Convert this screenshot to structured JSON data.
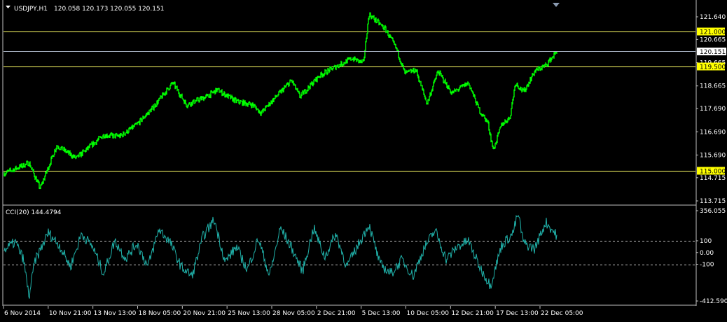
{
  "header": {
    "symbol_label": "USDJPY,H1",
    "ohlc_label": "120.058 120.173 120.055 120.151"
  },
  "colors": {
    "background": "#000000",
    "price_bars": "#00ff00",
    "indicator_line": "#20b2aa",
    "hline": "#ffff66",
    "current_price_line": "#a9b4c4",
    "frame": "#c0c0c0",
    "text": "#ffffff",
    "hline_label_bg": "#ffff00",
    "hline_label_text": "#000000"
  },
  "chart_data": [
    {
      "type": "line",
      "name": "price",
      "ylim": [
        113.715,
        121.64
      ],
      "y_ticks": [
        "121.640",
        "120.665",
        "119.665",
        "118.665",
        "117.690",
        "116.690",
        "115.690",
        "114.715",
        "113.715"
      ],
      "current_price": "120.151",
      "horizontal_lines": [
        {
          "value": "121.000"
        },
        {
          "value": "119.500"
        },
        {
          "value": "115.000"
        }
      ],
      "x": [
        "6 Nov 2014",
        "10 Nov 21:00",
        "13 Nov 13:00",
        "18 Nov 05:00",
        "20 Nov 21:00",
        "25 Nov 13:00",
        "28 Nov 05:00",
        "2 Dec 21:00",
        "5 Dec 13:00",
        "10 Dec 05:00",
        "12 Dec 21:00",
        "17 Dec 13:00",
        "22 Dec 05:00"
      ],
      "keypoints": [
        [
          0,
          114.9
        ],
        [
          0.045,
          115.35
        ],
        [
          0.065,
          114.25
        ],
        [
          0.095,
          116.1
        ],
        [
          0.13,
          115.55
        ],
        [
          0.18,
          116.55
        ],
        [
          0.21,
          116.5
        ],
        [
          0.24,
          117.0
        ],
        [
          0.27,
          117.75
        ],
        [
          0.305,
          118.8
        ],
        [
          0.33,
          117.85
        ],
        [
          0.37,
          118.25
        ],
        [
          0.385,
          118.5
        ],
        [
          0.42,
          118.0
        ],
        [
          0.45,
          117.85
        ],
        [
          0.465,
          117.5
        ],
        [
          0.48,
          117.9
        ],
        [
          0.52,
          118.9
        ],
        [
          0.535,
          118.2
        ],
        [
          0.57,
          119.1
        ],
        [
          0.6,
          119.5
        ],
        [
          0.63,
          119.85
        ],
        [
          0.65,
          119.65
        ],
        [
          0.66,
          121.75
        ],
        [
          0.69,
          121.1
        ],
        [
          0.71,
          120.25
        ],
        [
          0.725,
          119.2
        ],
        [
          0.745,
          119.35
        ],
        [
          0.765,
          117.9
        ],
        [
          0.785,
          119.3
        ],
        [
          0.81,
          118.35
        ],
        [
          0.84,
          118.8
        ],
        [
          0.86,
          117.6
        ],
        [
          0.875,
          117.1
        ],
        [
          0.885,
          115.9
        ],
        [
          0.9,
          117.0
        ],
        [
          0.915,
          117.3
        ],
        [
          0.925,
          118.8
        ],
        [
          0.94,
          118.4
        ],
        [
          0.96,
          119.3
        ],
        [
          0.98,
          119.55
        ],
        [
          1.0,
          120.15
        ]
      ]
    },
    {
      "type": "line",
      "name": "CCI(20)",
      "label": "CCI(20) 144.4794",
      "ylim": [
        -412.5903,
        356.055
      ],
      "y_ticks": [
        "356.055",
        "100",
        "0.00",
        "-100",
        "-412.5903"
      ],
      "levels": [
        100,
        -100
      ],
      "keypoints": [
        [
          0,
          20
        ],
        [
          0.02,
          90
        ],
        [
          0.035,
          -60
        ],
        [
          0.045,
          -380
        ],
        [
          0.055,
          -80
        ],
        [
          0.08,
          170
        ],
        [
          0.1,
          60
        ],
        [
          0.12,
          -120
        ],
        [
          0.14,
          160
        ],
        [
          0.16,
          50
        ],
        [
          0.18,
          -180
        ],
        [
          0.2,
          100
        ],
        [
          0.22,
          -50
        ],
        [
          0.24,
          80
        ],
        [
          0.26,
          -120
        ],
        [
          0.28,
          200
        ],
        [
          0.3,
          90
        ],
        [
          0.32,
          -120
        ],
        [
          0.34,
          -200
        ],
        [
          0.36,
          140
        ],
        [
          0.38,
          280
        ],
        [
          0.4,
          -80
        ],
        [
          0.42,
          50
        ],
        [
          0.44,
          -150
        ],
        [
          0.46,
          120
        ],
        [
          0.48,
          -200
        ],
        [
          0.5,
          210
        ],
        [
          0.52,
          40
        ],
        [
          0.54,
          -160
        ],
        [
          0.56,
          210
        ],
        [
          0.58,
          -40
        ],
        [
          0.6,
          160
        ],
        [
          0.62,
          -120
        ],
        [
          0.64,
          60
        ],
        [
          0.66,
          240
        ],
        [
          0.68,
          -100
        ],
        [
          0.7,
          -180
        ],
        [
          0.72,
          -60
        ],
        [
          0.74,
          -200
        ],
        [
          0.76,
          40
        ],
        [
          0.78,
          190
        ],
        [
          0.8,
          -60
        ],
        [
          0.82,
          50
        ],
        [
          0.84,
          100
        ],
        [
          0.86,
          -120
        ],
        [
          0.88,
          -280
        ],
        [
          0.9,
          60
        ],
        [
          0.92,
          160
        ],
        [
          0.93,
          330
        ],
        [
          0.94,
          80
        ],
        [
          0.96,
          30
        ],
        [
          0.98,
          260
        ],
        [
          1.0,
          144.5
        ]
      ]
    }
  ]
}
